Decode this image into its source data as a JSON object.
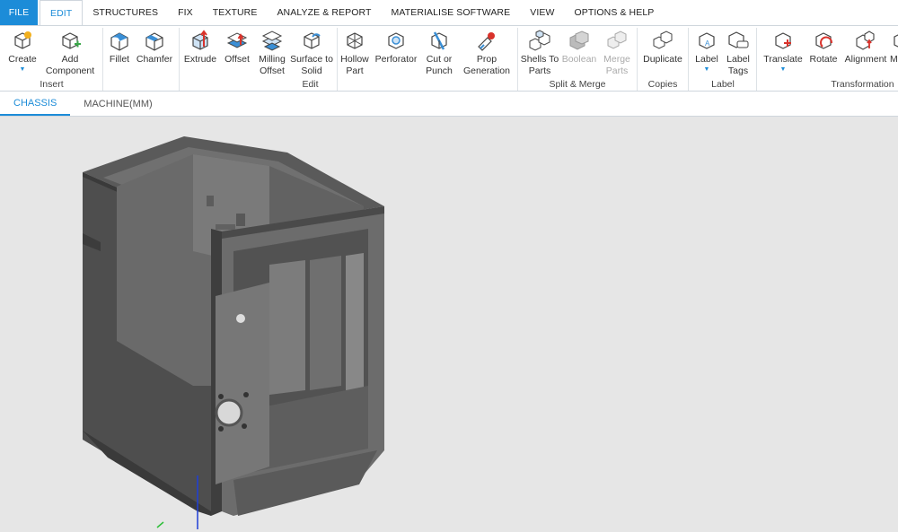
{
  "menu": {
    "items": [
      "FILE",
      "EDIT",
      "STRUCTURES",
      "FIX",
      "TEXTURE",
      "ANALYZE & REPORT",
      "MATERIALISE SOFTWARE",
      "VIEW",
      "OPTIONS & HELP"
    ],
    "active": "EDIT"
  },
  "ribbon": {
    "create": "Create",
    "add_component": "Add\nComponent",
    "fillet": "Fillet",
    "chamfer": "Chamfer",
    "extrude": "Extrude",
    "offset": "Offset",
    "milling_offset": "Milling\nOffset",
    "surface_to_solid": "Surface to\nSolid",
    "hollow_part": "Hollow\nPart",
    "perforator": "Perforator",
    "cut_or_punch": "Cut or\nPunch",
    "prop_generation": "Prop\nGeneration",
    "shells_to_parts": "Shells To\nParts",
    "boolean": "Boolean",
    "merge_parts": "Merge\nParts",
    "duplicate": "Duplicate",
    "label": "Label",
    "label_tags": "Label\nTags",
    "translate": "Translate",
    "rotate": "Rotate",
    "alignment": "Alignment",
    "more": "M"
  },
  "groups": {
    "insert": "Insert",
    "edit": "Edit",
    "split_merge": "Split & Merge",
    "copies": "Copies",
    "label": "Label",
    "transformation": "Transformation"
  },
  "tabs": [
    "CHASSIS",
    "MACHINE(MM)"
  ],
  "active_tab": "CHASSIS",
  "colors": {
    "accent": "#1c8cd8",
    "icon_blue": "#3a8fd6",
    "icon_red": "#d9322b",
    "icon_green": "#3aa84a",
    "viewport_bg": "#e6e6e6",
    "part_gray": "#5a5a5a"
  }
}
